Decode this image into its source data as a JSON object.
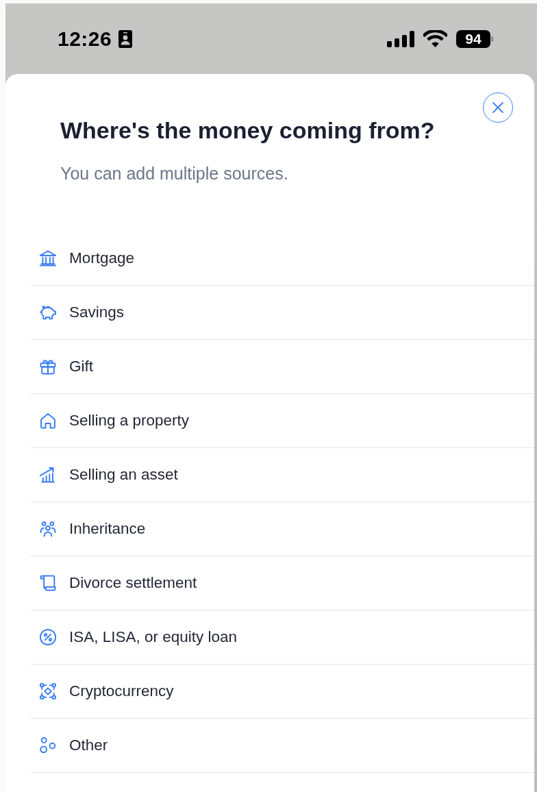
{
  "status_bar": {
    "time": "12:26",
    "battery": "94"
  },
  "sheet": {
    "title": "Where's the money coming from?",
    "subtitle": "You can add multiple sources."
  },
  "sources": [
    {
      "label": "Mortgage"
    },
    {
      "label": "Savings"
    },
    {
      "label": "Gift"
    },
    {
      "label": "Selling a property"
    },
    {
      "label": "Selling an asset"
    },
    {
      "label": "Inheritance"
    },
    {
      "label": "Divorce settlement"
    },
    {
      "label": "ISA, LISA, or equity loan"
    },
    {
      "label": "Cryptocurrency"
    },
    {
      "label": "Other"
    }
  ]
}
